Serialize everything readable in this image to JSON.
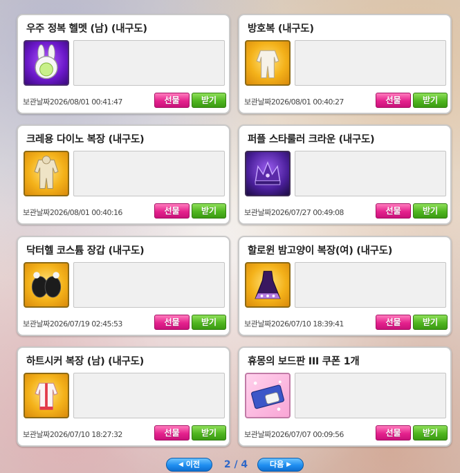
{
  "labels": {
    "date_label": "보관날짜",
    "gift_button": "선물",
    "receive_button": "받기"
  },
  "items": [
    {
      "title": "우주 정복 헬멧 (남) (내구도)",
      "date": "2026/08/01 00:41:47",
      "icon": "rabbit-helmet-icon"
    },
    {
      "title": "방호복 (내구도)",
      "date": "2026/08/01 00:40:27",
      "icon": "white-suit-icon"
    },
    {
      "title": "크레용 다이노 복장 (내구도)",
      "date": "2026/08/01 00:40:16",
      "icon": "dino-costume-icon"
    },
    {
      "title": "퍼플 스타룰러 크라운 (내구도)",
      "date": "2026/07/27 00:49:08",
      "icon": "purple-crown-icon"
    },
    {
      "title": "닥터헬 코스튬 장갑 (내구도)",
      "date": "2026/07/19 02:45:53",
      "icon": "black-gloves-icon"
    },
    {
      "title": "할로윈 밤고양이 복장(여) (내구도)",
      "date": "2026/07/10 18:39:41",
      "icon": "halloween-dress-icon"
    },
    {
      "title": "하트시커 복장 (남) (내구도)",
      "date": "2026/07/10 18:27:32",
      "icon": "heartseeker-outfit-icon"
    },
    {
      "title": "휴몽의 보드판 III 쿠폰 1개",
      "date": "2026/07/07 00:09:56",
      "icon": "coupon-ticket-icon"
    }
  ],
  "pagination": {
    "prev_label": "이전",
    "next_label": "다음",
    "current": "2 / 4"
  },
  "colors": {
    "gift": "#e4228d",
    "receive": "#4fb51f",
    "pager": "#1f8ef0",
    "page_number": "#2f68c8"
  }
}
